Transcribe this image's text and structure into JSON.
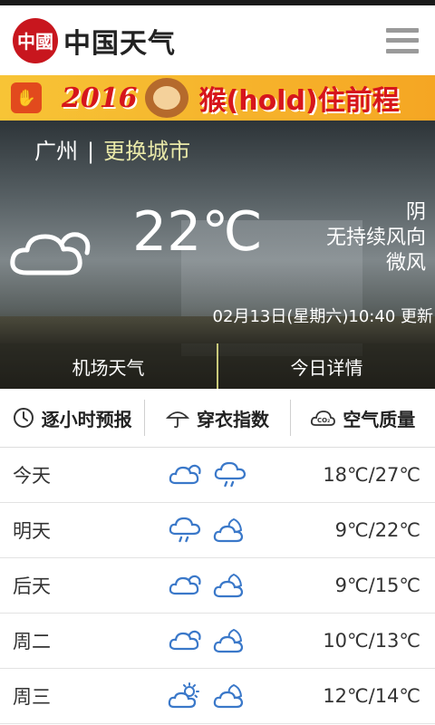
{
  "header": {
    "brand": "中国天气",
    "seal_text": "中國"
  },
  "ad": {
    "year": "2016",
    "slogan": "猴(hold)住前程"
  },
  "current": {
    "city": "广州",
    "separator": "|",
    "change_city": "更换城市",
    "temperature": "22℃",
    "condition": "阴",
    "wind": "无持续风向",
    "wind_level": "微风",
    "updated": "02月13日(星期六)10:40 更新"
  },
  "hero_tabs": [
    "机场天气",
    "今日详情"
  ],
  "tabs": [
    {
      "label": "逐小时预报",
      "icon": "clock-icon"
    },
    {
      "label": "穿衣指数",
      "icon": "umbrella-icon"
    },
    {
      "label": "空气质量",
      "icon": "co2-cloud-icon"
    }
  ],
  "forecast": [
    {
      "day": "今天",
      "range": "18℃/27℃",
      "day_icon": "cloudy-icon",
      "night_icon": "rain-icon"
    },
    {
      "day": "明天",
      "range": "9℃/22℃",
      "day_icon": "rain-icon",
      "night_icon": "moon-cloud-icon"
    },
    {
      "day": "后天",
      "range": "9℃/15℃",
      "day_icon": "cloudy-icon",
      "night_icon": "moon-cloud-icon"
    },
    {
      "day": "周二",
      "range": "10℃/13℃",
      "day_icon": "cloudy-icon",
      "night_icon": "moon-cloud-icon"
    },
    {
      "day": "周三",
      "range": "12℃/14℃",
      "day_icon": "sun-cloud-icon",
      "night_icon": "moon-cloud-icon"
    }
  ],
  "colors": {
    "accent_icon": "#3a78c9",
    "seal_red": "#c8161e",
    "link_yellow": "#e8e8a8"
  }
}
